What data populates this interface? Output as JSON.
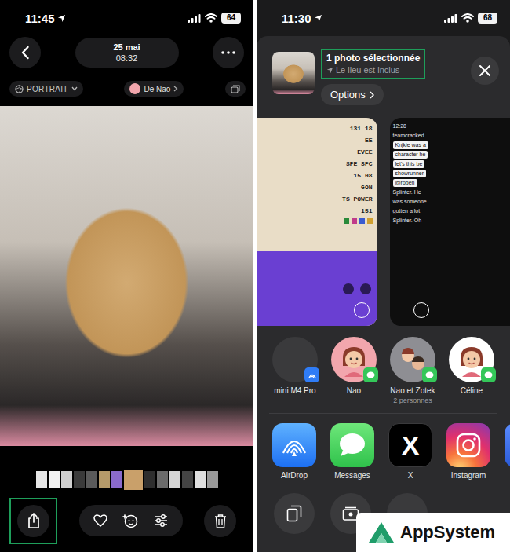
{
  "viewer": {
    "status_bar": {
      "time": "11:45",
      "battery": "64"
    },
    "date": "25 mai",
    "time": "08:32",
    "mode": "PORTRAIT",
    "author": "De Nao",
    "thumbnails": [
      {
        "selected": false,
        "color": "#e6e6e6"
      },
      {
        "selected": false,
        "color": "#f2f2f2"
      },
      {
        "selected": false,
        "color": "#cfcfcf"
      },
      {
        "selected": false,
        "color": "#3a3a3a"
      },
      {
        "selected": false,
        "color": "#5a5a5a"
      },
      {
        "selected": false,
        "color": "#b59a6a"
      },
      {
        "selected": false,
        "color": "#8a6acb"
      },
      {
        "selected": true,
        "color": "#c9a06a"
      },
      {
        "selected": false,
        "color": "#2e2e2e"
      },
      {
        "selected": false,
        "color": "#6b6b6b"
      },
      {
        "selected": false,
        "color": "#d6d6d6"
      },
      {
        "selected": false,
        "color": "#444444"
      },
      {
        "selected": false,
        "color": "#e0e0e0"
      },
      {
        "selected": false,
        "color": "#9a9a9a"
      }
    ],
    "toolbar": {
      "share_highlighted": true,
      "favorite": false
    }
  },
  "share_sheet": {
    "status_bar": {
      "time": "11:30",
      "battery": "68"
    },
    "header": {
      "title": "1 photo sélectionnée",
      "subtitle": "Le lieu est inclus",
      "highlighted": true
    },
    "options": "Options",
    "items": [
      {
        "kind": "game",
        "selected": false,
        "lines": [
          "131  18",
          "EE",
          "EVEE",
          "SPE SPC",
          "15  08",
          "GON",
          "TS POWER",
          "151"
        ]
      },
      {
        "kind": "photo",
        "selected": true,
        "lines": []
      },
      {
        "kind": "chat",
        "selected": false,
        "lines": [
          "12:28",
          "teamcracked",
          "Knjkie was a",
          "character he",
          "let's this be",
          "showrunner",
          "@roben",
          "Splinter. He",
          "was someone",
          "gotten a lot",
          "Splinter. Oh"
        ]
      }
    ],
    "contacts": [
      {
        "name": "mini M4 Pro",
        "subtitle": "",
        "kind": "device",
        "color": "#3a3a3c"
      },
      {
        "name": "Nao",
        "subtitle": "",
        "kind": "person",
        "color": "#f2a6ad"
      },
      {
        "name": "Nao et Zotek",
        "subtitle": "2 personnes",
        "kind": "group",
        "color": "#8e8e93"
      },
      {
        "name": "Céline",
        "subtitle": "",
        "kind": "person",
        "color": "#ffffff"
      }
    ],
    "apps": [
      {
        "name": "AirDrop",
        "kind": "airdrop",
        "glyph": ""
      },
      {
        "name": "Messages",
        "kind": "messages",
        "glyph": ""
      },
      {
        "name": "X",
        "kind": "x",
        "glyph": "X"
      },
      {
        "name": "Instagram",
        "kind": "instagram",
        "glyph": ""
      }
    ]
  },
  "watermark": {
    "text": "AppSystem"
  }
}
